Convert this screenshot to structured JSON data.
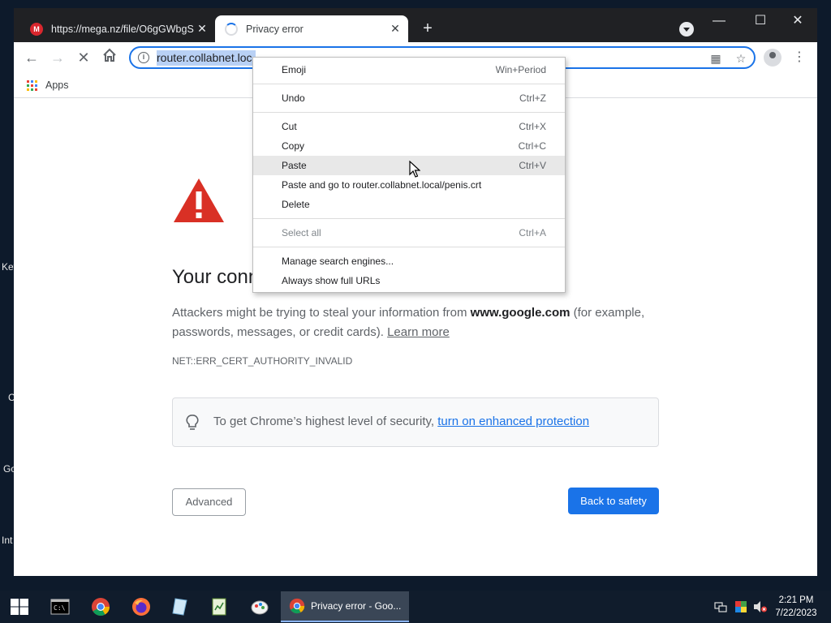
{
  "desktop": {
    "labels": [
      "Key",
      "C",
      "Go",
      "Int"
    ]
  },
  "tabs": [
    {
      "title": "https://mega.nz/file/O6gGWbgS",
      "favicon": "mega-icon"
    },
    {
      "title": "Privacy error",
      "favicon": "loading-spinner-icon"
    }
  ],
  "window_controls": {
    "minimize": "—",
    "maximize": "☐",
    "close": "✕"
  },
  "omnibox": {
    "url_visible": "router.collabnet.loc"
  },
  "bookmarks": {
    "apps_label": "Apps"
  },
  "page": {
    "heading": "Your conn",
    "para_before": "Attackers might be trying to steal your information from ",
    "para_domain": "www.google.com",
    "para_after": " (for example, passwords, messages, or credit cards). ",
    "learn_more": "Learn more",
    "error_code": "NET::ERR_CERT_AUTHORITY_INVALID",
    "tip_text": "To get Chrome’s highest level of security, ",
    "tip_link": "turn on enhanced protection",
    "advanced_button": "Advanced",
    "back_button": "Back to safety"
  },
  "context_menu": {
    "items": [
      {
        "label": "Emoji",
        "shortcut": "Win+Period"
      },
      {
        "label": "Undo",
        "shortcut": "Ctrl+Z"
      },
      {
        "label": "Cut",
        "shortcut": "Ctrl+X"
      },
      {
        "label": "Copy",
        "shortcut": "Ctrl+C"
      },
      {
        "label": "Paste",
        "shortcut": "Ctrl+V"
      },
      {
        "label": "Paste and go to router.collabnet.local/penis.crt",
        "shortcut": ""
      },
      {
        "label": "Delete",
        "shortcut": ""
      },
      {
        "label": "Select all",
        "shortcut": "Ctrl+A"
      },
      {
        "label": "Manage search engines...",
        "shortcut": ""
      },
      {
        "label": "Always show full URLs",
        "shortcut": ""
      }
    ],
    "highlighted": "Paste"
  },
  "taskbar": {
    "active_window": "Privacy error - Goo...",
    "time": "2:21 PM",
    "date": "7/22/2023"
  },
  "colors": {
    "accent": "#1a73e8",
    "warning_red": "#d93025",
    "titlebar": "#202124"
  }
}
